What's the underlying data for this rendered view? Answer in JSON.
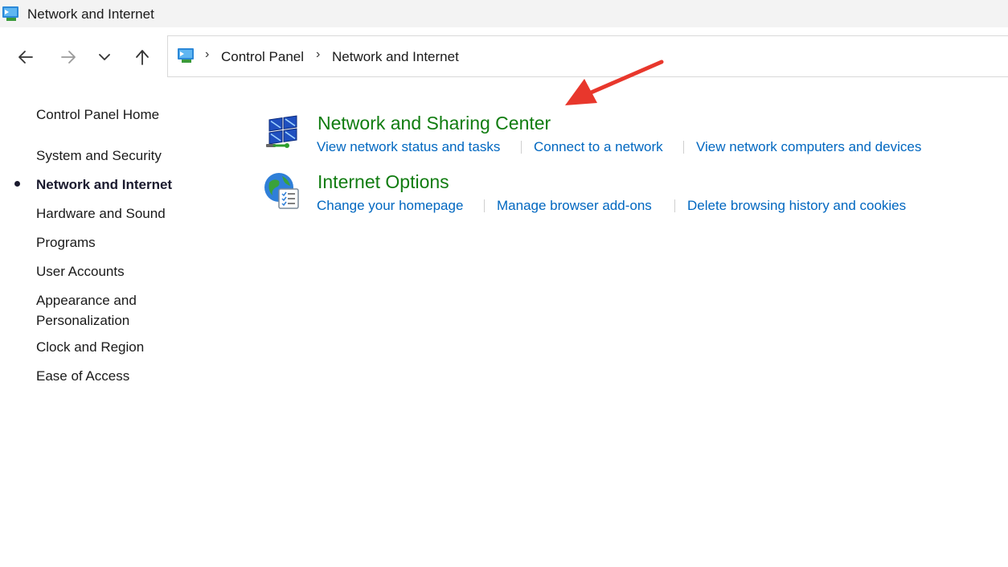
{
  "window": {
    "title": "Network and Internet"
  },
  "address_bar": {
    "breadcrumbs": [
      "Control Panel",
      "Network and Internet"
    ]
  },
  "left_nav": {
    "home": "Control Panel Home",
    "items": [
      {
        "label": "System and Security",
        "active": false
      },
      {
        "label": "Network and Internet",
        "active": true
      },
      {
        "label": "Hardware and Sound",
        "active": false
      },
      {
        "label": "Programs",
        "active": false
      },
      {
        "label": "User Accounts",
        "active": false
      },
      {
        "label": "Appearance and",
        "label2": "Personalization",
        "active": false
      },
      {
        "label": "Clock and Region",
        "active": false
      },
      {
        "label": "Ease of Access",
        "active": false
      }
    ]
  },
  "categories": [
    {
      "title": "Network and Sharing Center",
      "icon": "network-sharing-icon",
      "tasks": [
        "View network status and tasks",
        "Connect to a network",
        "View network computers and devices"
      ]
    },
    {
      "title": "Internet Options",
      "icon": "internet-options-icon",
      "tasks": [
        "Change your homepage",
        "Manage browser add-ons",
        "Delete browsing history and cookies"
      ]
    }
  ],
  "colors": {
    "category_title": "#107c10",
    "task_link": "#0067c0",
    "annotation_arrow": "#e8372c"
  }
}
